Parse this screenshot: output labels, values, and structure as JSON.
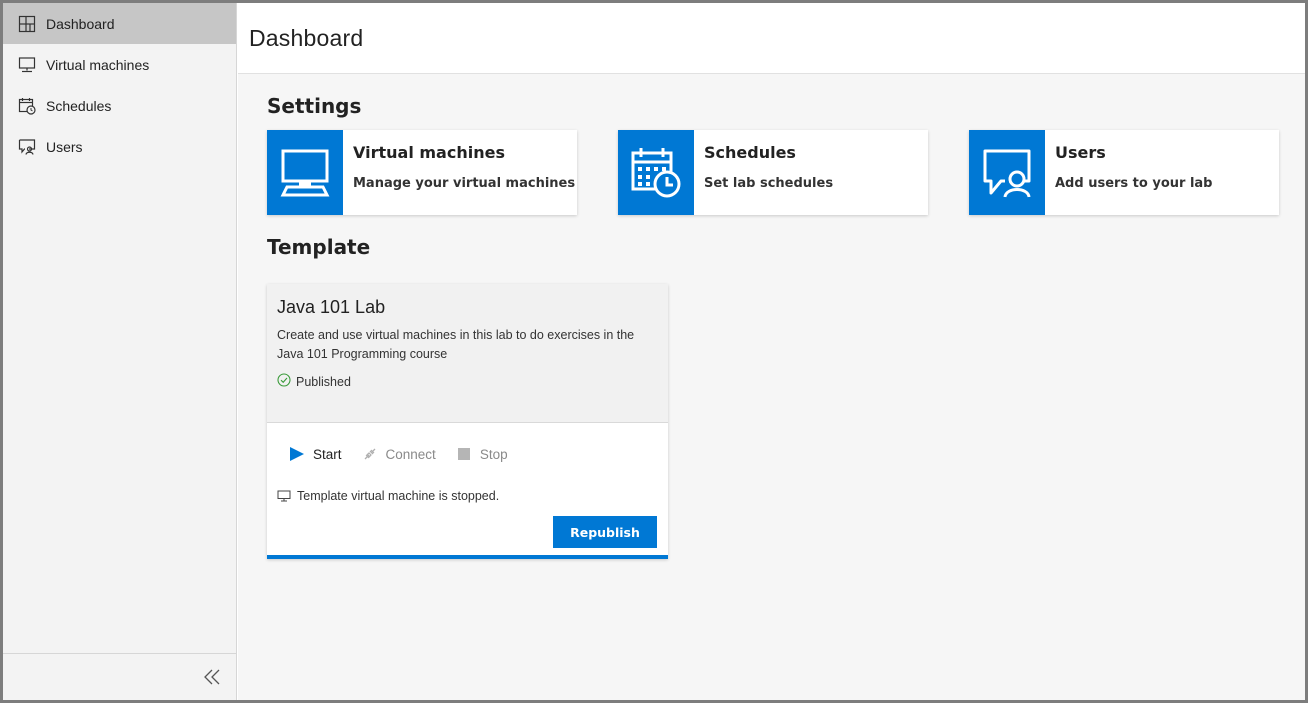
{
  "sidebar": {
    "items": [
      {
        "label": "Dashboard",
        "icon": "dashboard-icon",
        "active": true
      },
      {
        "label": "Virtual machines",
        "icon": "monitor-icon",
        "active": false
      },
      {
        "label": "Schedules",
        "icon": "calendar-clock-icon",
        "active": false
      },
      {
        "label": "Users",
        "icon": "user-chat-icon",
        "active": false
      }
    ],
    "collapse_icon": "double-chevron-left-icon"
  },
  "header": {
    "title": "Dashboard"
  },
  "settings": {
    "section_title": "Settings",
    "tiles": [
      {
        "title": "Virtual machines",
        "subtitle": "Manage your virtual machines",
        "icon": "monitor-icon"
      },
      {
        "title": "Schedules",
        "subtitle": "Set lab schedules",
        "icon": "calendar-clock-icon"
      },
      {
        "title": "Users",
        "subtitle": "Add users to your lab",
        "icon": "user-chat-icon"
      }
    ]
  },
  "template": {
    "section_title": "Template",
    "card": {
      "title": "Java 101 Lab",
      "description": "Create and use virtual machines in this lab to do exercises in the Java 101 Programming course",
      "status": "Published",
      "actions": {
        "start": "Start",
        "connect": "Connect",
        "stop": "Stop"
      },
      "vm_status": "Template virtual machine is stopped.",
      "republish_label": "Republish"
    }
  },
  "colors": {
    "accent": "#0078d4",
    "sidebar_active": "#c6c6c6",
    "published_green": "#3a9b3a"
  }
}
